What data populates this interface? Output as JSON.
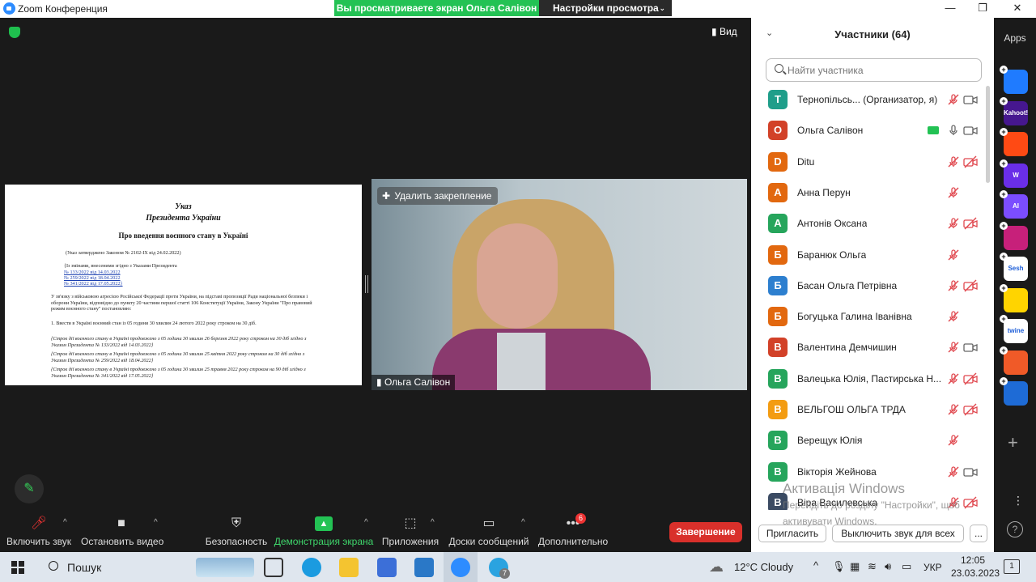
{
  "window": {
    "title": "Zoom Конференция",
    "share_banner": "Вы просматриваете экран Ольга Салівон",
    "view_settings": "Настройки просмотра"
  },
  "main": {
    "view_label": "Вид",
    "unpin_label": "Удалить закрепление",
    "video_label": "Ольга Салівон"
  },
  "document": {
    "title1": "Указ",
    "title2": "Президента України",
    "title3": "Про введення воєнного стану в Україні",
    "approved": "(Указ затверджено Законом № 2102-IX від 24.02.2022)",
    "changes": "{Із змінами, внесеними згідно з Указами Президента",
    "changes_1": "№ 133/2022 від 14.03.2022",
    "changes_2": "№ 259/2022 від 18.04.2022",
    "changes_3": "№ 341/2022 від 17.05.2022}",
    "para1": "У зв'язку з військовою агресією Російської Федерації проти України, на підставі пропозиції Ради національної безпеки і оборони України, відповідно до пункту 20 частини першої статті 106 Конституції України, Закону України \"Про правовий режим воєнного стану\" постановляю:",
    "para2": "1. Ввести в Україні воєнний стан із 05 години 30 хвилин 24 лютого 2022 року строком на 30 діб.",
    "para3": "{Строк дії воєнного стану в Україні продовжено з 05 години 30 хвилин 26 березня 2022 року строком на 30 діб згідно з Указом Президента № 133/2022 від 14.03.2022}",
    "para4": "{Строк дії воєнного стану в Україні продовжено з 05 години 30 хвилин 25 квітня 2022 року строком на 30 діб згідно з Указом Президента № 259/2022 від 18.04.2022}",
    "para5": "{Строк дії воєнного стану в Україні продовжено з 05 години 30 хвилин 25 травня 2022 року строком на 90 діб згідно з Указом Президента № 341/2022 від 17.05.2022}"
  },
  "toolbar": {
    "unmute": "Включить звук",
    "stop_video": "Остановить видео",
    "security": "Безопасность",
    "share_screen": "Демонстрация экрана",
    "apps": "Приложения",
    "whiteboards": "Доски сообщений",
    "more": "Дополнительно",
    "more_badge": "6",
    "end": "Завершение"
  },
  "panel": {
    "title": "Участники (64)",
    "search_placeholder": "Найти участника",
    "participants": [
      {
        "initial": "Т",
        "name": "Тернопільсь... (Организатор, я)",
        "color": "#1f9e8a",
        "mic": "muted",
        "cam": "on"
      },
      {
        "initial": "О",
        "name": "Ольга Салівон",
        "color": "#d24128",
        "mic": "on",
        "cam": "on",
        "sharing": true
      },
      {
        "initial": "D",
        "name": "Ditu",
        "color": "#e2680f",
        "mic": "muted",
        "cam": "off"
      },
      {
        "initial": "А",
        "name": "Анна Перун",
        "color": "#e2680f",
        "mic": "muted",
        "cam": "none"
      },
      {
        "initial": "А",
        "name": "Антонів Оксана",
        "color": "#26a55c",
        "mic": "muted",
        "cam": "off"
      },
      {
        "initial": "Б",
        "name": "Баранюк Ольга",
        "color": "#e2680f",
        "mic": "muted",
        "cam": "none"
      },
      {
        "initial": "Б",
        "name": "Басан Ольга Петрівна",
        "color": "#2d7fcf",
        "mic": "muted",
        "cam": "off"
      },
      {
        "initial": "Б",
        "name": "Богуцька Галина Іванівна",
        "color": "#e2680f",
        "mic": "muted",
        "cam": "none"
      },
      {
        "initial": "В",
        "name": "Валентина Демчишин",
        "color": "#d24128",
        "mic": "muted",
        "cam": "on"
      },
      {
        "initial": "В",
        "name": "Валецька Юлія, Пастирська Н...",
        "color": "#26a55c",
        "mic": "muted",
        "cam": "off"
      },
      {
        "initial": "В",
        "name": "ВЕЛЬГОШ ОЛЬГА ТРДА",
        "color": "#f39c12",
        "mic": "muted",
        "cam": "off"
      },
      {
        "initial": "В",
        "name": "Верещук Юлія",
        "color": "#26a55c",
        "mic": "muted",
        "cam": "none"
      },
      {
        "initial": "В",
        "name": "Вікторія Жейнова",
        "color": "#26a55c",
        "mic": "muted",
        "cam": "on"
      },
      {
        "initial": "В",
        "name": "Віра Василевська",
        "color": "#3b4b63",
        "mic": "muted",
        "cam": "off"
      }
    ],
    "invite": "Пригласить",
    "mute_all": "Выключить звук для всех",
    "more": "..."
  },
  "activation": {
    "line1": "Активація Windows",
    "line2": "Щоб активувати Windows, перейдіть до розділу \"Настройки\".",
    "line2_visible": "Перейдіть до розділу \"Настройки\", щоб",
    "line3": "активувати Windows."
  },
  "apps": {
    "title": "Apps",
    "items": [
      {
        "name": "app-1",
        "color": "#1f7bff",
        "label": ""
      },
      {
        "name": "kahoot",
        "color": "#46178f",
        "label": "Kahoot!"
      },
      {
        "name": "app-3",
        "color": "#ff4a14",
        "label": ""
      },
      {
        "name": "wordwall",
        "color": "#6a2ee8",
        "label": "W"
      },
      {
        "name": "app-5",
        "color": "#7b4dff",
        "label": "AI"
      },
      {
        "name": "app-6",
        "color": "#c7207a",
        "label": ""
      },
      {
        "name": "sesh",
        "color": "#ffffff",
        "label": "Sesh"
      },
      {
        "name": "app-8",
        "color": "#ffd400",
        "label": ""
      },
      {
        "name": "twine",
        "color": "#ffffff",
        "label": "twine"
      },
      {
        "name": "app-10",
        "color": "#f05a28",
        "label": ""
      },
      {
        "name": "app-11",
        "color": "#1e6bd6",
        "label": ""
      }
    ]
  },
  "taskbar": {
    "search": "Пошук",
    "weather": "12°C Cloudy",
    "lang": "УКР",
    "time": "12:05",
    "date": "23.03.2023",
    "telegram_badge": "7",
    "notif_badge": "1"
  }
}
